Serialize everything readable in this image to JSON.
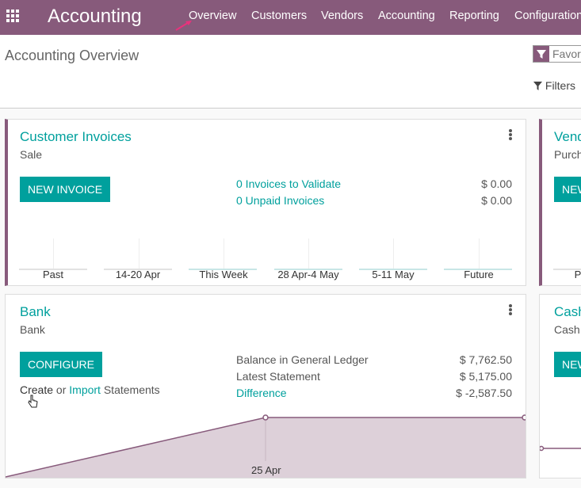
{
  "navbar": {
    "brand": "Accounting",
    "menu": [
      "Overview",
      "Customers",
      "Vendors",
      "Accounting",
      "Reporting",
      "Configuration"
    ]
  },
  "control": {
    "title": "Accounting Overview",
    "search_placeholder": "Favori",
    "filters_label": "Filters"
  },
  "customer_invoices": {
    "title": "Customer Invoices",
    "subtitle": "Sale",
    "button": "NEW INVOICE",
    "rows": [
      {
        "label": "0 Invoices to Validate",
        "amount": "$ 0.00"
      },
      {
        "label": "0 Unpaid Invoices",
        "amount": "$ 0.00"
      }
    ],
    "chart_labels": [
      "Past",
      "14-20 Apr",
      "This Week",
      "28 Apr-4 May",
      "5-11 May",
      "Future"
    ]
  },
  "vendor_card": {
    "title": "Vend",
    "subtitle": "Purch",
    "button": "NEW",
    "chart_label": "P"
  },
  "bank": {
    "title": "Bank",
    "subtitle": "Bank",
    "button": "CONFIGURE",
    "create_link": "Create",
    "or_text": "or",
    "import_link": "Import",
    "statements_text": "Statements",
    "rows": [
      {
        "label": "Balance in General Ledger",
        "amount": "$ 7,762.50"
      },
      {
        "label": "Latest Statement",
        "amount": "$ 5,175.00"
      },
      {
        "label": "Difference",
        "amount": "$ -2,587.50"
      }
    ],
    "chart_x_label": "25 Apr"
  },
  "cash_card": {
    "title": "Cash",
    "subtitle": "Cash",
    "button": "NEW"
  },
  "colors": {
    "brand": "#875a7b",
    "accent": "#00a09d"
  }
}
